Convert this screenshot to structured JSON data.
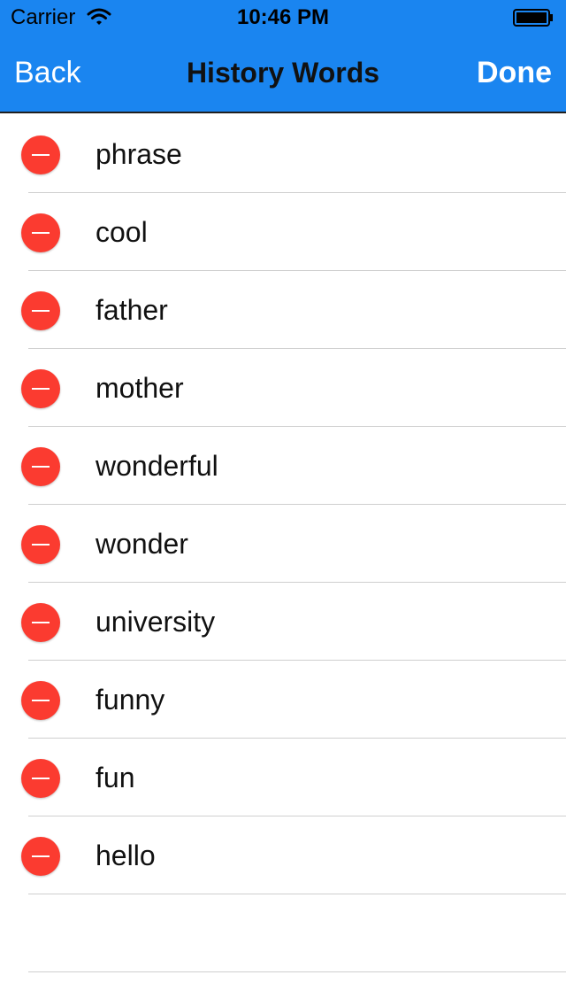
{
  "status_bar": {
    "carrier": "Carrier",
    "time": "10:46 PM",
    "wifi_icon": "wifi-icon",
    "battery_icon": "battery-icon"
  },
  "nav": {
    "back_label": "Back",
    "title": "History Words",
    "done_label": "Done"
  },
  "colors": {
    "nav_background": "#1a85f0",
    "delete_red": "#fb3b30",
    "separator": "#cfcfcf"
  },
  "words": [
    {
      "label": "phrase"
    },
    {
      "label": "cool"
    },
    {
      "label": "father"
    },
    {
      "label": "mother"
    },
    {
      "label": "wonderful"
    },
    {
      "label": "wonder"
    },
    {
      "label": "university"
    },
    {
      "label": "funny"
    },
    {
      "label": "fun"
    },
    {
      "label": "hello"
    }
  ]
}
